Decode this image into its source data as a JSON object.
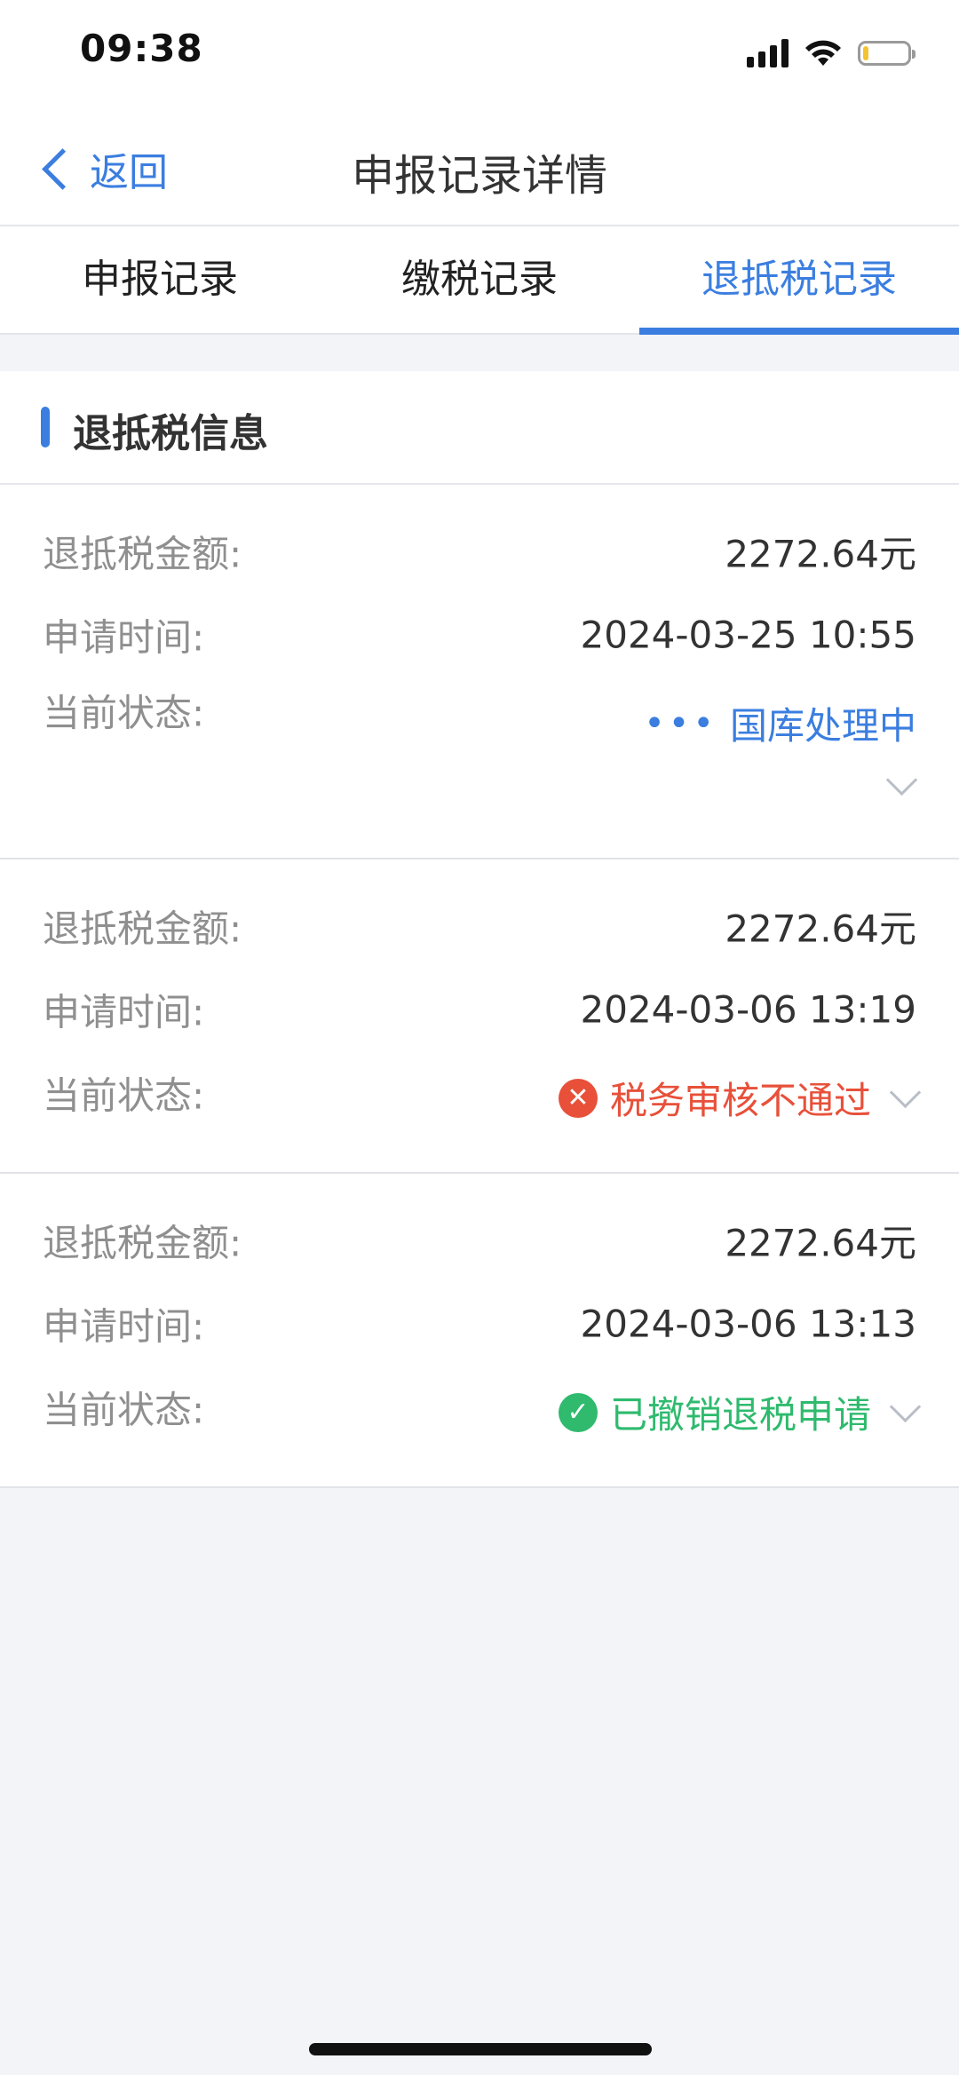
{
  "status_bar": {
    "time": "09:38",
    "icons": [
      "signal-icon",
      "wifi-icon",
      "battery-icon"
    ]
  },
  "nav": {
    "back_label": "返回",
    "title": "申报记录详情"
  },
  "tabs": [
    {
      "label": "申报记录",
      "active": false
    },
    {
      "label": "缴税记录",
      "active": false
    },
    {
      "label": "退抵税记录",
      "active": true
    }
  ],
  "section": {
    "title": "退抵税信息"
  },
  "labels": {
    "amount": "退抵税金额:",
    "time": "申请时间:",
    "status": "当前状态:"
  },
  "records": [
    {
      "amount": "2272.64元",
      "time": "2024-03-25 10:55",
      "status": "国库处理中",
      "status_icon": "dots-icon",
      "status_color": "#3b7ee0"
    },
    {
      "amount": "2272.64元",
      "time": "2024-03-06 13:19",
      "status": "税务审核不通过",
      "status_icon": "error-circle-icon",
      "status_color": "#e8503a"
    },
    {
      "amount": "2272.64元",
      "time": "2024-03-06 13:13",
      "status": "已撤销退税申请",
      "status_icon": "check-circle-icon",
      "status_color": "#2fba6e"
    }
  ],
  "colors": {
    "accent": "#3b7ee0",
    "background": "#f2f4f8",
    "error": "#e8503a",
    "success": "#2fba6e"
  }
}
